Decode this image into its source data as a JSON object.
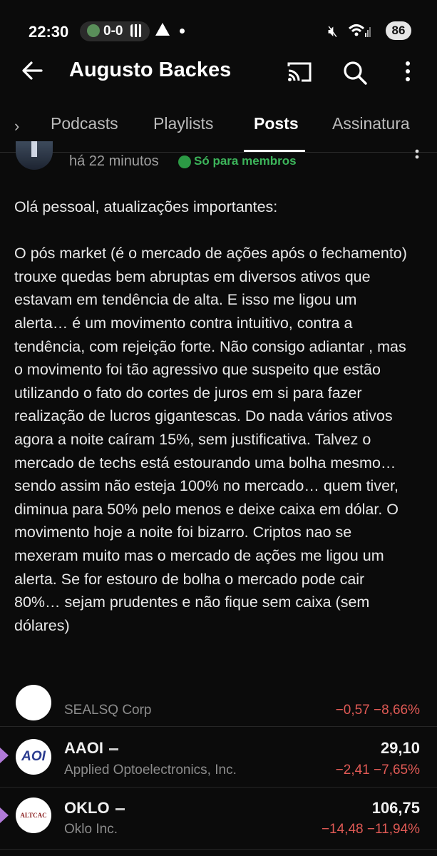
{
  "status_bar": {
    "time": "22:30",
    "score": "0-0",
    "battery": "86"
  },
  "app_bar": {
    "title": "Augusto Backes"
  },
  "tabs": [
    {
      "label": "Podcasts"
    },
    {
      "label": "Playlists"
    },
    {
      "label": "Posts"
    },
    {
      "label": "Assinatura"
    }
  ],
  "post": {
    "time": "há 22 minutos",
    "member_badge": "Só para membros",
    "paragraph1": "Olá pessoal, atualizações importantes:",
    "paragraph2": "O pós market (é o mercado de ações após o fechamento) trouxe quedas bem abruptas em diversos ativos que estavam em tendência de alta. E isso me ligou um alerta… é um movimento contra intuitivo, contra a tendência, com rejeição forte. Não consigo adiantar , mas o movimento foi tão agressivo que suspeito que estão utilizando o fato do cortes de juros em si para fazer realização de lucros gigantescas. Do nada vários ativos agora a noite caíram 15%, sem justificativa. Talvez o mercado de techs está estourando uma bolha mesmo… sendo assim não esteja 100% no mercado… quem tiver, diminua para 50% pelo menos e deixe caixa em dólar. O movimento hoje a noite foi bizarro. Criptos nao se mexeram muito mas o mercado de ações me ligou um alerta. Se for estouro de bolha o mercado pode cair 80%… sejam prudentes e não fique sem caixa (sem dólares)"
  },
  "stocks": [
    {
      "name": "SEALSQ Corp",
      "change": "−0,57  −8,66%"
    },
    {
      "logo": "AOI",
      "ticker": "AAOI",
      "name": "Applied Optoelectronics, Inc.",
      "price": "29,10",
      "change": "−2,41  −7,65%"
    },
    {
      "logo": "ALTCAC",
      "ticker": "OKLO",
      "name": "Oklo Inc.",
      "price": "106,75",
      "change": "−14,48  −11,94%"
    }
  ],
  "colors": {
    "member_green": "#3cb45a",
    "negative_red": "#e05a55",
    "accent_bookmark": "#b07ad8"
  }
}
